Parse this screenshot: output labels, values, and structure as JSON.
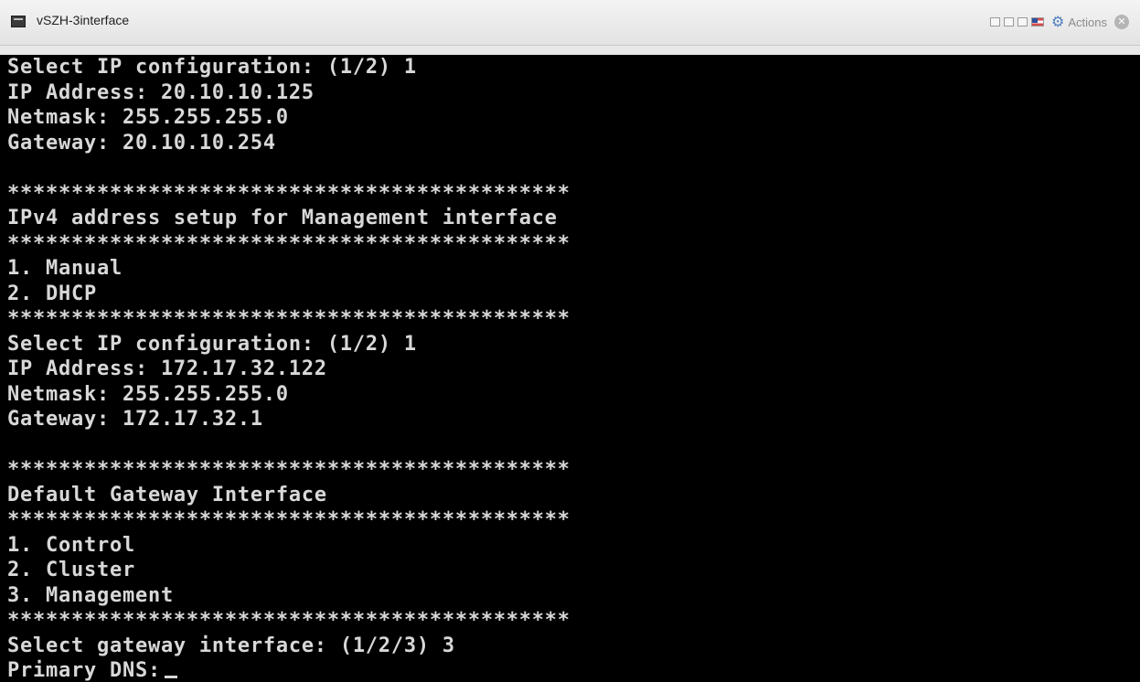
{
  "window": {
    "title": "vSZH-3interface",
    "actions_label": "Actions"
  },
  "icons": {
    "console": "console-icon",
    "flag": "flag-icon",
    "gear": "gear-icon",
    "close": "close-icon"
  },
  "terminal": {
    "lines": [
      "Select IP configuration: (1/2) 1",
      "IP Address: 20.10.10.125",
      "Netmask: 255.255.255.0",
      "Gateway: 20.10.10.254",
      "",
      "********************************************",
      "IPv4 address setup for Management interface",
      "********************************************",
      "1. Manual",
      "2. DHCP",
      "********************************************",
      "Select IP configuration: (1/2) 1",
      "IP Address: 172.17.32.122",
      "Netmask: 255.255.255.0",
      "Gateway: 172.17.32.1",
      "",
      "********************************************",
      "Default Gateway Interface",
      "********************************************",
      "1. Control",
      "2. Cluster",
      "3. Management",
      "********************************************",
      "Select gateway interface: (1/2/3) 3",
      "Primary DNS:"
    ]
  }
}
